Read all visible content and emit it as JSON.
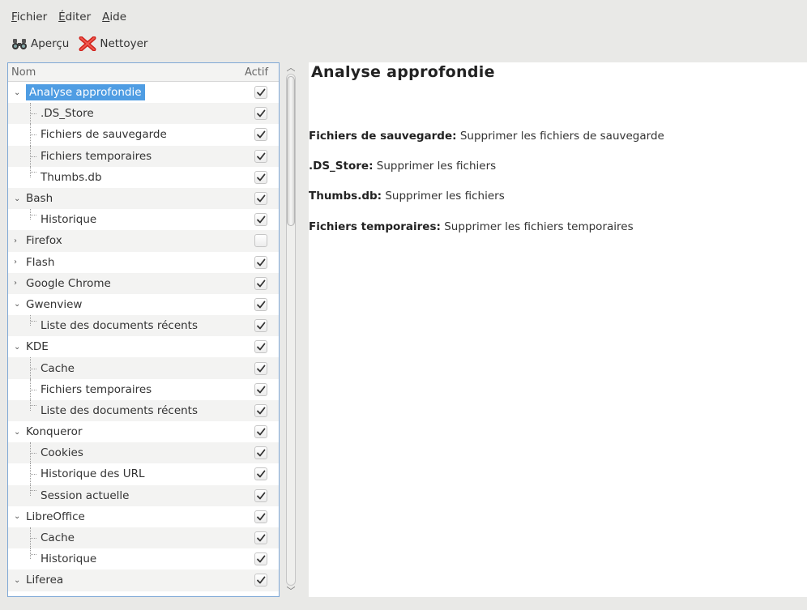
{
  "menu": [
    {
      "accel": "F",
      "rest": "ichier"
    },
    {
      "accel": "É",
      "rest": "diter"
    },
    {
      "accel": "A",
      "rest": "ide"
    }
  ],
  "toolbar": {
    "preview_label": "Aperçu",
    "clean_label": "Nettoyer",
    "preview_icon": "binoculars-icon",
    "clean_icon": "red-x-icon"
  },
  "tree": {
    "col_name": "Nom",
    "col_active": "Actif",
    "rows": [
      {
        "label": "Analyse approfondie",
        "level": 0,
        "expanded": true,
        "checked": true,
        "selected": true
      },
      {
        "label": ".DS_Store",
        "level": 1,
        "checked": true
      },
      {
        "label": "Fichiers de sauvegarde",
        "level": 1,
        "checked": true
      },
      {
        "label": "Fichiers temporaires",
        "level": 1,
        "checked": true
      },
      {
        "label": "Thumbs.db",
        "level": 1,
        "checked": true,
        "last": true
      },
      {
        "label": "Bash",
        "level": 0,
        "expanded": true,
        "checked": true
      },
      {
        "label": "Historique",
        "level": 1,
        "checked": true,
        "last": true
      },
      {
        "label": "Firefox",
        "level": 0,
        "expanded": false,
        "checked": false
      },
      {
        "label": "Flash",
        "level": 0,
        "expanded": false,
        "checked": true
      },
      {
        "label": "Google Chrome",
        "level": 0,
        "expanded": false,
        "checked": true
      },
      {
        "label": "Gwenview",
        "level": 0,
        "expanded": true,
        "checked": true
      },
      {
        "label": "Liste des documents récents",
        "level": 1,
        "checked": true,
        "last": true
      },
      {
        "label": "KDE",
        "level": 0,
        "expanded": true,
        "checked": true
      },
      {
        "label": "Cache",
        "level": 1,
        "checked": true
      },
      {
        "label": "Fichiers temporaires",
        "level": 1,
        "checked": true
      },
      {
        "label": "Liste des documents récents",
        "level": 1,
        "checked": true,
        "last": true
      },
      {
        "label": "Konqueror",
        "level": 0,
        "expanded": true,
        "checked": true
      },
      {
        "label": "Cookies",
        "level": 1,
        "checked": true
      },
      {
        "label": "Historique des URL",
        "level": 1,
        "checked": true
      },
      {
        "label": "Session actuelle",
        "level": 1,
        "checked": true,
        "last": true
      },
      {
        "label": "LibreOffice",
        "level": 0,
        "expanded": true,
        "checked": true
      },
      {
        "label": "Cache",
        "level": 1,
        "checked": true
      },
      {
        "label": "Historique",
        "level": 1,
        "checked": true,
        "last": true
      },
      {
        "label": "Liferea",
        "level": 0,
        "expanded": true,
        "checked": true
      }
    ]
  },
  "details": {
    "title": "Analyse approfondie",
    "lines": [
      {
        "key": "Fichiers de sauvegarde:",
        "value": "Supprimer les fichiers de sauvegarde"
      },
      {
        "key": ".DS_Store:",
        "value": "Supprimer les fichiers"
      },
      {
        "key": "Thumbs.db:",
        "value": "Supprimer les fichiers"
      },
      {
        "key": "Fichiers temporaires:",
        "value": "Supprimer les fichiers temporaires"
      }
    ]
  },
  "colors": {
    "selection": "#4f9de3",
    "panel_border": "#7fa8d6",
    "window_bg": "#e9e9e7"
  }
}
